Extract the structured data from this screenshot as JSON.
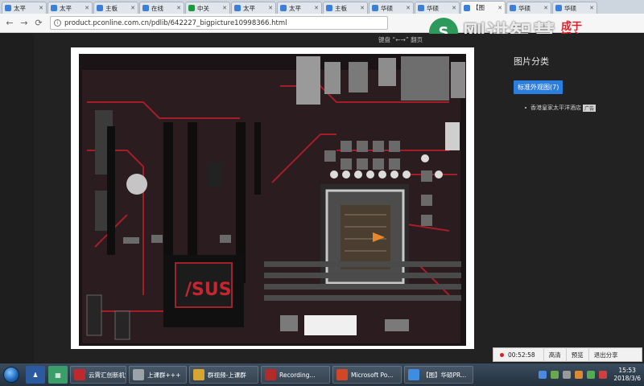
{
  "browser": {
    "tabs": [
      {
        "label": "太平",
        "color": "#3c7fd8",
        "active": false
      },
      {
        "label": "太平",
        "color": "#3c7fd8",
        "active": false
      },
      {
        "label": "主板",
        "color": "#3c7fd8",
        "active": false
      },
      {
        "label": "在线",
        "color": "#3c7fd8",
        "active": false
      },
      {
        "label": "中关",
        "color": "#1a9a3a",
        "active": false
      },
      {
        "label": "太平",
        "color": "#3c7fd8",
        "active": false
      },
      {
        "label": "太平",
        "color": "#3c7fd8",
        "active": false
      },
      {
        "label": "主板",
        "color": "#3c7fd8",
        "active": false
      },
      {
        "label": "华硕",
        "color": "#3c7fd8",
        "active": false
      },
      {
        "label": "华硕",
        "color": "#3c7fd8",
        "active": false
      },
      {
        "label": "【图",
        "color": "#3c7fd8",
        "active": true
      },
      {
        "label": "华硕",
        "color": "#3c7fd8",
        "active": false
      },
      {
        "label": "华硕",
        "color": "#3c7fd8",
        "active": false
      }
    ],
    "url": "product.pconline.com.cn/pdlib/642227_bigpicture10998366.html"
  },
  "watermark": {
    "logo_text": "刚讲智慧",
    "seal_text": "成于知心"
  },
  "page": {
    "keyboard_hint": "键盘 “←→” 翻页",
    "side_panel": {
      "title": "图片分类",
      "category_button": "标准外观图(7)",
      "list_item": "香港皇家太平洋酒店",
      "thumb_tag": "广告"
    }
  },
  "recorder": {
    "time": "00:52:58",
    "hd": "高清",
    "preview": "预览",
    "exit_share": "退出分享"
  },
  "taskbar": {
    "items": [
      {
        "label": "云霄汇创新机策",
        "color": "#c0282d"
      },
      {
        "label": "上课群+++",
        "color": "#9aa2aa"
      },
      {
        "label": "群视频-上课群",
        "color": "#d9a531"
      },
      {
        "label": "Recording...",
        "color": "#b22a2a"
      },
      {
        "label": "Microsoft Po...",
        "color": "#d24726"
      },
      {
        "label": "【图】华硕PR...",
        "color": "#3e8de0"
      }
    ],
    "clock_time": "15:53",
    "clock_date": "2018/3/6"
  }
}
